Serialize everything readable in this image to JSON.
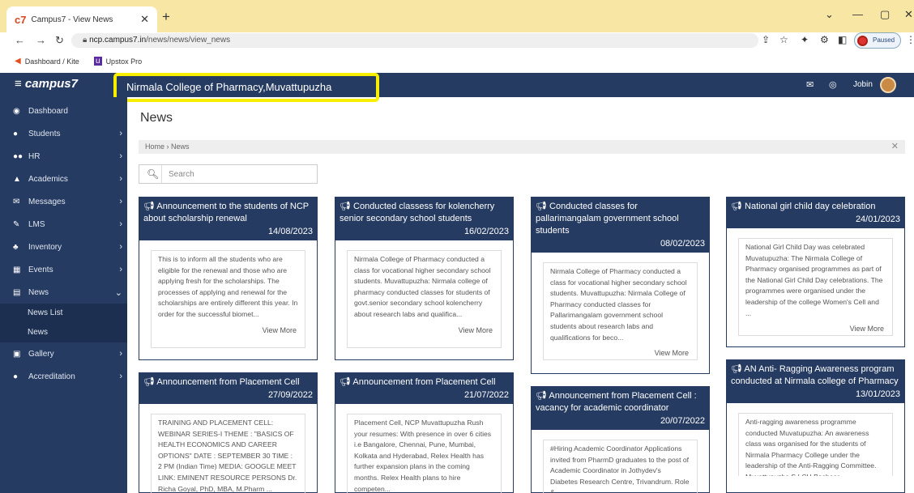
{
  "browser": {
    "tab_title": "Campus7 - View News",
    "url_host": "ncp.campus7.in",
    "url_path": "/news/news/view_news",
    "profile_status": "Paused",
    "bookmarks": [
      {
        "label": "Dashboard / Kite"
      },
      {
        "label": "Upstox Pro"
      }
    ]
  },
  "app": {
    "logo": "campus7",
    "college_name": "Nirmala College of Pharmacy,Muvattupuzha",
    "user_name": "Jobin"
  },
  "sidebar": {
    "items": [
      {
        "label": "Dashboard",
        "icon": "dashboard-icon",
        "chevron": ""
      },
      {
        "label": "Students",
        "icon": "user-icon",
        "chevron": "›"
      },
      {
        "label": "HR",
        "icon": "users-icon",
        "chevron": "›"
      },
      {
        "label": "Academics",
        "icon": "graduation-cap-icon",
        "chevron": "›"
      },
      {
        "label": "Messages",
        "icon": "envelope-icon",
        "chevron": "›"
      },
      {
        "label": "LMS",
        "icon": "edit-icon",
        "chevron": "›"
      },
      {
        "label": "Inventory",
        "icon": "inventory-icon",
        "chevron": "›"
      },
      {
        "label": "Events",
        "icon": "calendar-icon",
        "chevron": "›"
      },
      {
        "label": "News",
        "icon": "newspaper-icon",
        "chevron": "⌄"
      },
      {
        "label": "Gallery",
        "icon": "image-icon",
        "chevron": "›"
      },
      {
        "label": "Accreditation",
        "icon": "circle-icon",
        "chevron": "›"
      }
    ],
    "news_sub": [
      "News List",
      "News"
    ]
  },
  "page": {
    "title": "News",
    "breadcrumb": "Home › News",
    "search_placeholder": "Search"
  },
  "cards": [
    {
      "title": "Announcement to the students of NCP about scholarship renewal",
      "date": "14/08/2023",
      "body": "This is to inform all the students who are eligible for the renewal and those who are applying fresh for the scholarships. The processes of applying and renewal for the scholarships are entirely different this year. In order for the successful biomet...",
      "more": "View More"
    },
    {
      "title": "Conducted classess for kolencherry senior secondary school students",
      "date": "16/02/2023",
      "body": "Nirmala College of Pharmacy conducted a class for vocational higher secondary school students. Muvattupuzha: Nirmala college of pharmacy conducted classes for students of govt.senior secondary school kolencherry about research labs and qualifica...",
      "more": "View More"
    },
    {
      "title": "Conducted classes for pallarimangalam government school students",
      "date": "08/02/2023",
      "body": "Nirmala College of Pharmacy conducted a class for vocational higher secondary school students. Muvattupuzha: Nirmala College of Pharmacy conducted classes for Pallarimangalam government school students about research labs and qualifications for beco...",
      "more": "View More"
    },
    {
      "title": "National girl child day celebration",
      "date": "24/01/2023",
      "body": "National Girl Child Day was celebrated Muvatupuzha: The Nirmala College of Pharmacy organised programmes as part of the National Girl Child Day celebrations. The programmes were organised under the leadership of the college Women's Cell and ...",
      "more": "View More"
    },
    {
      "title": "Announcement from Placement Cell",
      "date": "27/09/2022",
      "body": "TRAINING AND PLACEMENT CELL: WEBINAR SERIES-I THEME : \"BASICS OF HEALTH ECONOMICS AND CAREER OPTIONS\" DATE : SEPTEMBER 30 TIME : 2 PM (Indian Time) MEDIA: GOOGLE MEET LINK: EMINENT RESOURCE PERSONS Dr. Richa Goyal, PhD, MBA, M.Pharm ...",
      "more": ""
    },
    {
      "title": "Announcement from Placement Cell",
      "date": "21/07/2022",
      "body": "Placement Cell, NCP Muvattupuzha Rush your resumes: With presence in over 6 cities i.e Bangalore, Chennai, Pune, Mumbai, Kolkata and Hyderabad, Relex Health has further expansion plans in the coming months. Relex Health plans to hire competen...",
      "more": ""
    },
    {
      "title": "Announcement from Placement Cell : vacancy for academic coordinator",
      "date": "20/07/2022",
      "body": "#Hiring Academic Coordinator Applications invited from PharmD graduates to the post of Academic Coordinator in Jothydev's Diabetes Research Centre, Trivandrum. Role &...",
      "more": ""
    },
    {
      "title": "AN Anti- Ragging Awareness program conducted at Nirmala college of Pharmacy",
      "date": "13/01/2023",
      "body": "Anti-ragging awareness programme conducted Muvatupuzha: An awareness class was organised for the students of Nirmala Pharmacy College under the leadership of the Anti-Ragging Committee. Muvattupuzha S.I CH Basheer ...",
      "more": ""
    }
  ]
}
